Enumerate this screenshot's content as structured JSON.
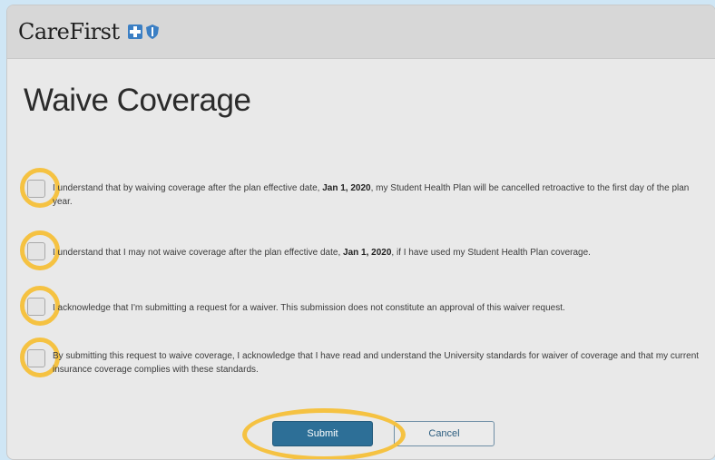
{
  "header": {
    "brand": "CareFirst",
    "icons": [
      "blue-cross-icon",
      "blue-shield-icon"
    ]
  },
  "page": {
    "title": "Waive Coverage"
  },
  "acknowledgements": [
    {
      "text_before": "I understand that by waiving coverage after the plan effective date, ",
      "bold": "Jan 1, 2020",
      "text_after": ", my Student Health Plan will be cancelled retroactive to the first day of the plan year."
    },
    {
      "text_before": "I understand that I may not waive coverage after the plan effective date, ",
      "bold": "Jan 1, 2020",
      "text_after": ", if I have used my Student Health Plan coverage."
    },
    {
      "text_before": "I acknowledge that I'm submitting a request for a waiver. This submission does not constitute an approval of this waiver request.",
      "bold": "",
      "text_after": ""
    },
    {
      "text_before": "By submitting this request to waive coverage, I acknowledge that I have read and understand the University standards for waiver of coverage and that my current insurance coverage complies with these standards.",
      "bold": "",
      "text_after": ""
    }
  ],
  "buttons": {
    "submit": "Submit",
    "cancel": "Cancel"
  },
  "colors": {
    "highlight": "#f5c242",
    "primary": "#2d6f97",
    "title": "#2b2b2b"
  }
}
